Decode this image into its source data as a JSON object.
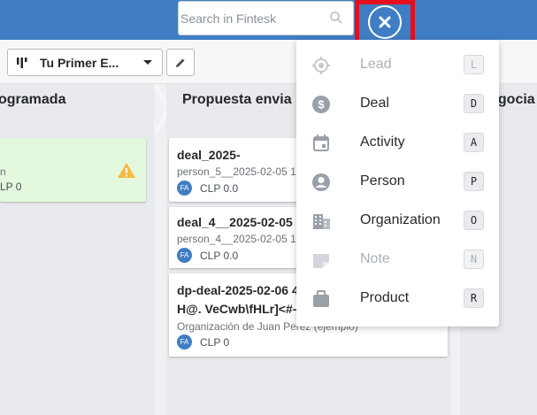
{
  "search": {
    "placeholder": "Search in Fintesk",
    "value": ""
  },
  "toolbar": {
    "pipeline_label": "Tu Primer E..."
  },
  "columns": [
    {
      "title": "ogramada"
    },
    {
      "title": "Propuesta envia"
    },
    {
      "title": "egocia"
    }
  ],
  "cards_left": [
    {
      "sub": "n",
      "value": "LP 0"
    }
  ],
  "cards_mid": [
    {
      "title": "deal_2025-",
      "sub": "person_5__2025-02-05 1",
      "avatar": "FA",
      "value": "CLP 0.0"
    },
    {
      "title": "deal_4__2025-02-05",
      "sub": "person_4__2025-02-05 1",
      "avatar": "FA",
      "value": "CLP 0.0"
    },
    {
      "title": "dp-deal-2025-02-06 4",
      "title2": "H@. VeCwb\\fHLr]<#-",
      "sub": "Organización de Juan Perez (ejemplo)",
      "avatar": "FA",
      "value": "CLP 0"
    }
  ],
  "menu": {
    "items": [
      {
        "label": "Lead",
        "key": "L",
        "icon": "target-icon",
        "disabled": true
      },
      {
        "label": "Deal",
        "key": "D",
        "icon": "dollar-icon",
        "disabled": false
      },
      {
        "label": "Activity",
        "key": "A",
        "icon": "calendar-icon",
        "disabled": false
      },
      {
        "label": "Person",
        "key": "P",
        "icon": "person-icon",
        "disabled": false
      },
      {
        "label": "Organization",
        "key": "O",
        "icon": "building-icon",
        "disabled": false
      },
      {
        "label": "Note",
        "key": "N",
        "icon": "note-icon",
        "disabled": true
      },
      {
        "label": "Product",
        "key": "R",
        "icon": "briefcase-icon",
        "disabled": false
      }
    ]
  },
  "colors": {
    "topbar": "#3f7ec4",
    "highlight": "#e5101b",
    "warning": "#f5b942",
    "green_card": "#e3f8dc"
  }
}
